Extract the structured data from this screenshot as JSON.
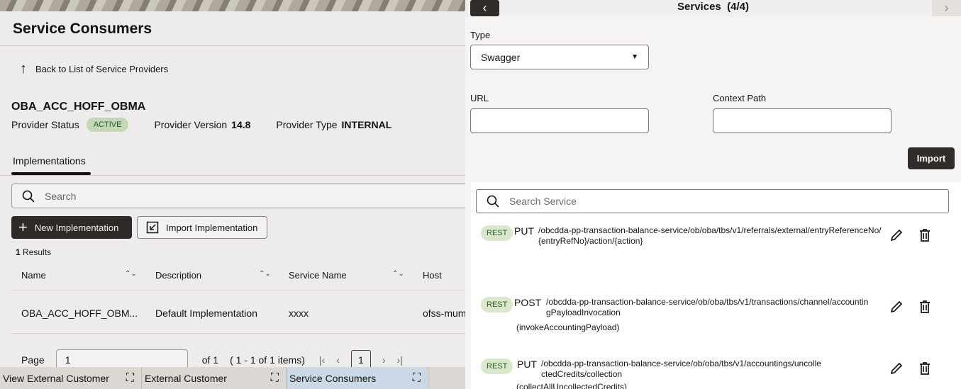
{
  "background": {
    "page_title": "Service Consumers",
    "back_link": "Back to List of Service Providers",
    "provider": {
      "name": "OBA_ACC_HOFF_OBMA",
      "status_label": "Provider Status",
      "status": "ACTIVE",
      "version_label": "Provider Version",
      "version": "14.8",
      "type_label": "Provider Type",
      "type": "INTERNAL"
    },
    "tab": "Implementations",
    "search_placeholder": "Search",
    "new_button": "New Implementation",
    "import_button": "Import Implementation",
    "results_count": "1",
    "results_label": "Results",
    "columns": [
      "Name",
      "Description",
      "Service Name",
      "Host"
    ],
    "row": [
      "OBA_ACC_HOFF_OBM...",
      "Default Implementation",
      "xxxx",
      "ofss-mum"
    ],
    "pager": {
      "page_label": "Page",
      "page_value": "1",
      "of_label": "of 1",
      "range": "( 1 - 1 of 1 items)",
      "current": "1"
    },
    "tasks": [
      "View External Customer",
      "External Customer",
      "Service Consumers"
    ]
  },
  "drawer": {
    "title": "Services",
    "counter": "(4/4)",
    "type_label": "Type",
    "type_value": "Swagger",
    "url_label": "URL",
    "url_value": "",
    "context_label": "Context Path",
    "context_value": "",
    "import_button": "Import",
    "search_placeholder": "Search Service",
    "services": [
      {
        "protocol": "REST",
        "method": "PUT",
        "path": "/obcdda-pp-transaction-balance-service/ob/oba/tbs/v1/referrals/external/entryReferenceNo/{entryRefNo}/action/{action}",
        "operation": ""
      },
      {
        "protocol": "REST",
        "method": "POST",
        "path": "/obcdda-pp-transaction-balance-service/ob/oba/tbs/v1/transactions/channel/accountingPayloadInvocation",
        "operation": "(invokeAccountingPayload)"
      },
      {
        "protocol": "REST",
        "method": "PUT",
        "path": "/obcdda-pp-transaction-balance-service/ob/oba/tbs/v1/accountings/uncollectedCredits/collection",
        "operation": "(collectAllUncollectedCredits)"
      }
    ]
  }
}
